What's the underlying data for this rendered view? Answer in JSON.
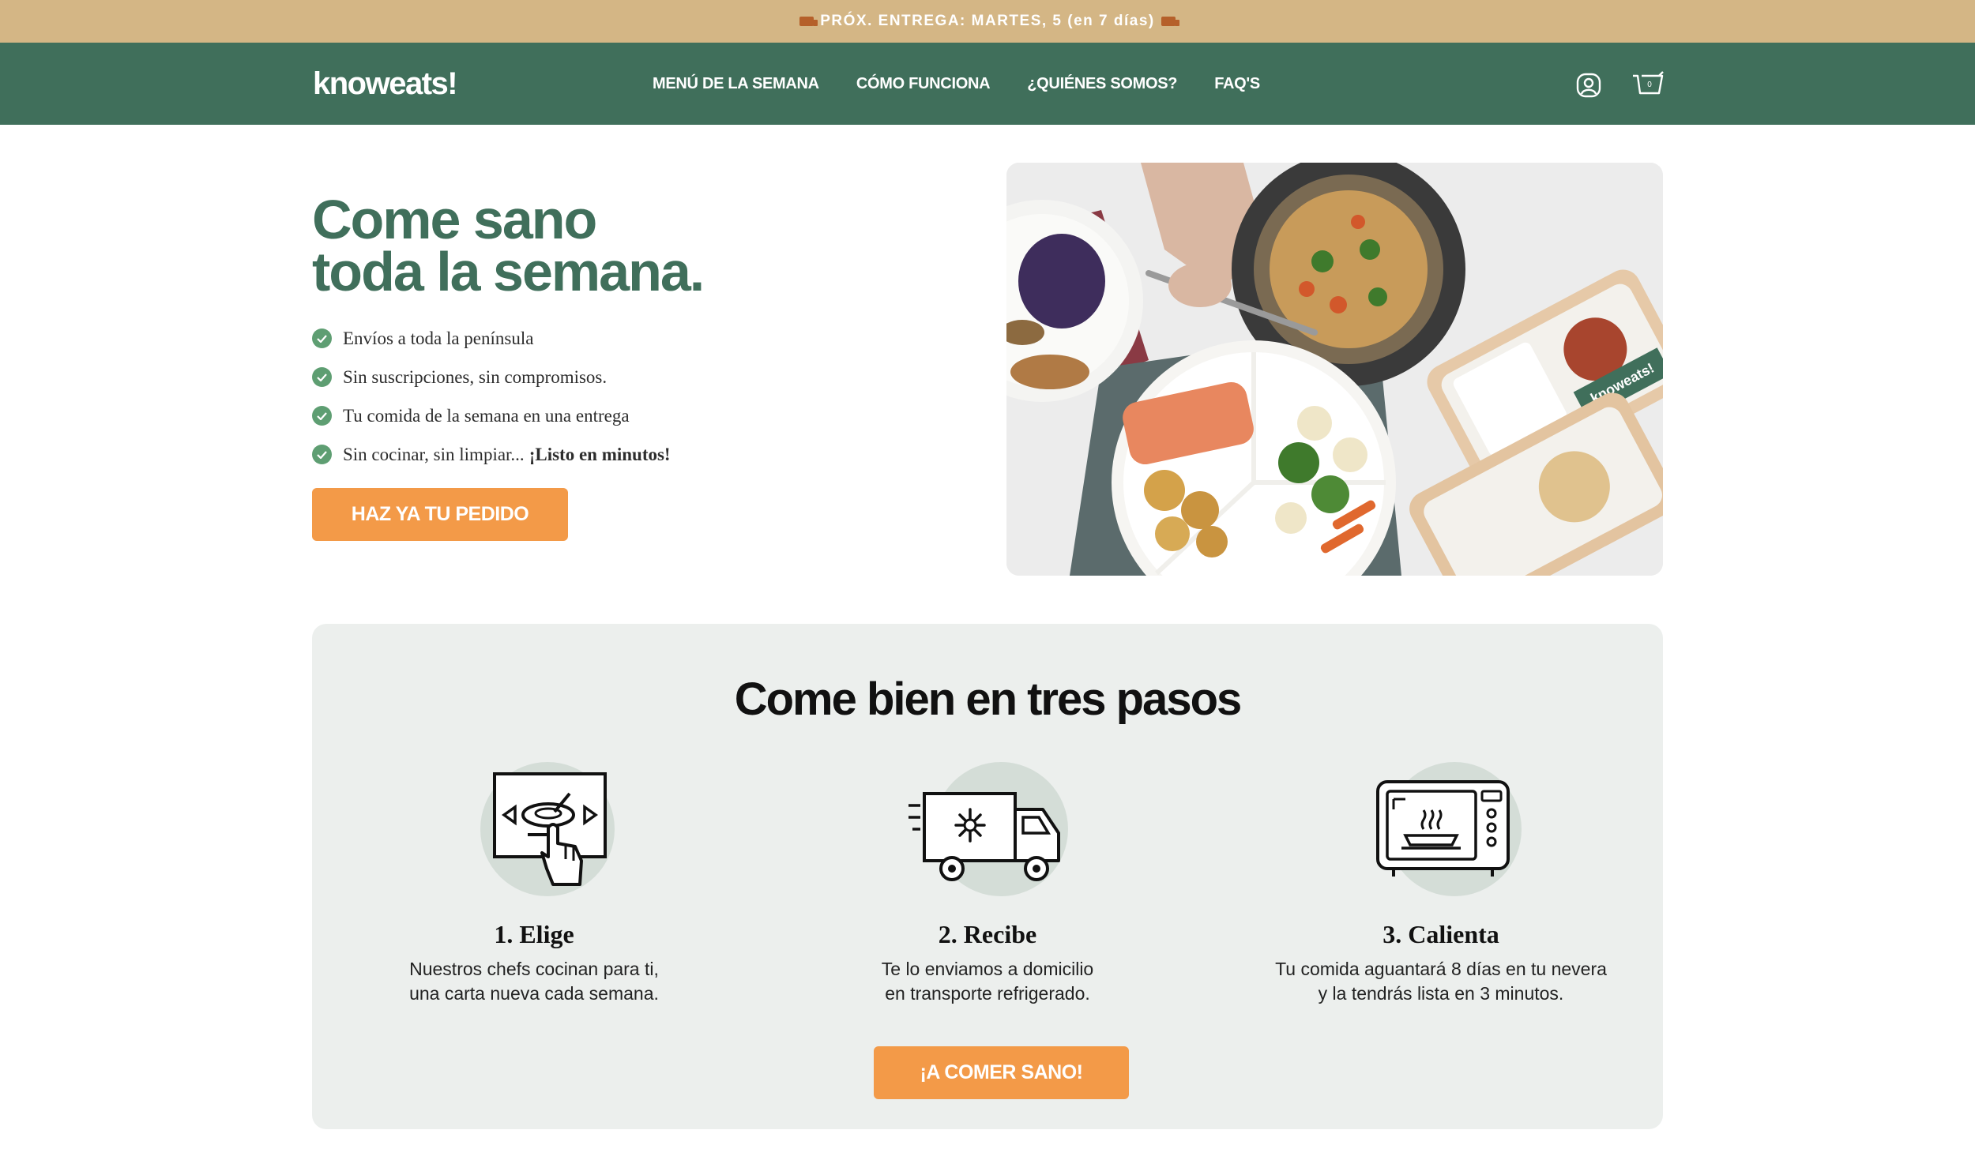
{
  "announcement": {
    "text": "PRÓX. ENTREGA: MARTES, 5 (en 7 días)",
    "icon": "delivery-truck-icon"
  },
  "nav": {
    "logo": "knoweats!",
    "links": [
      "MENÚ DE LA SEMANA",
      "CÓMO FUNCIONA",
      "¿QUIÉNES SOMOS?",
      "FAQ'S"
    ],
    "icons": [
      "user-account-icon",
      "shopping-cart-icon"
    ],
    "cart_count": "0"
  },
  "hero": {
    "title_line1": "Come sano",
    "title_line2": "toda la semana.",
    "features": [
      {
        "text": "Envíos a toda la península"
      },
      {
        "text": "Sin suscripciones, sin compromisos."
      },
      {
        "text": "Tu comida de la semana en una entrega"
      },
      {
        "text": "Sin cocinar, sin limpiar...",
        "bold": "¡Listo en minutos!"
      }
    ],
    "cta": "HAZ YA TU PEDIDO",
    "image_label": "knoweats!"
  },
  "steps": {
    "title": "Come bien en tres pasos",
    "items": [
      {
        "title": "1. Elige",
        "desc_line1": "Nuestros chefs cocinan para ti,",
        "desc_line2": "una carta nueva cada semana.",
        "icon": "menu-select-hand-icon"
      },
      {
        "title": "2. Recibe",
        "desc_line1": "Te lo enviamos a domicilio",
        "desc_line2": "en transporte refrigerado.",
        "icon": "refrigerated-truck-icon"
      },
      {
        "title": "3. Calienta",
        "desc_line1": "Tu comida aguantará 8 días en tu nevera",
        "desc_line2": "y la tendrás lista en 3 minutos.",
        "icon": "microwave-icon"
      }
    ],
    "cta": "¡A COMER SANO!"
  },
  "colors": {
    "announce_bg": "#d4b685",
    "nav_bg": "#406f5b",
    "accent": "#f39a48",
    "title_green": "#406f5b",
    "check_green": "#5e9e72",
    "card_bg": "#ecefed"
  }
}
